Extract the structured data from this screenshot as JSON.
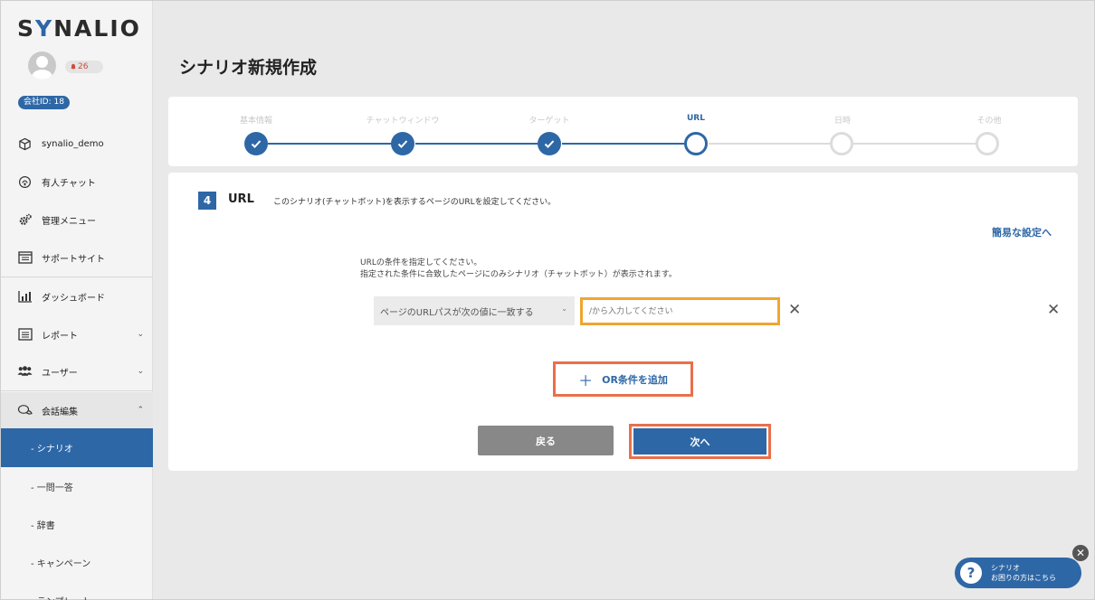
{
  "logo": {
    "pre": "S",
    "y": "Y",
    "post": "NALIO"
  },
  "user": {
    "notif_count": "26",
    "company_id": "会社ID: 18"
  },
  "nav": [
    {
      "label": "synalio_demo",
      "icon": "box-icon"
    },
    {
      "label": "有人チャット",
      "icon": "headset-icon"
    },
    {
      "label": "管理メニュー",
      "icon": "gears-icon"
    },
    {
      "label": "サポートサイト",
      "icon": "window-icon"
    },
    {
      "label": "ダッシュボード",
      "icon": "bar-chart-icon"
    },
    {
      "label": "レポート",
      "icon": "list-icon"
    },
    {
      "label": "ユーザー",
      "icon": "users-icon"
    },
    {
      "label": "会話編集",
      "icon": "chat-icon"
    }
  ],
  "subnav": [
    {
      "label": "- シナリオ",
      "active": true
    },
    {
      "label": "- 一問一答"
    },
    {
      "label": "- 辞書"
    },
    {
      "label": "- キャンペーン"
    },
    {
      "label": "- テンプレート"
    }
  ],
  "page_title": "シナリオ新規作成",
  "steps": [
    {
      "label": "基本情報",
      "state": "done"
    },
    {
      "label": "チャットウィンドウ",
      "state": "done"
    },
    {
      "label": "ターゲット",
      "state": "done"
    },
    {
      "label": "URL",
      "state": "current"
    },
    {
      "label": "日時",
      "state": "todo"
    },
    {
      "label": "その他",
      "state": "todo"
    }
  ],
  "section": {
    "number": "4",
    "title": "URL",
    "description": "このシナリオ(チャットボット)を表示するページのURLを設定してください。",
    "simple_link": "簡易な設定へ",
    "instruction_1": "URLの条件を指定してください。",
    "instruction_2": "指定された条件に合致したページにのみシナリオ（チャットボット）が表示されます。",
    "condition_select": "ページのURLパスが次の値に一致する",
    "url_placeholder": "/から入力してください",
    "or_button": "OR条件を追加",
    "back_button": "戻る",
    "next_button": "次へ"
  },
  "help": {
    "line1": "シナリオ",
    "line2": "お困りの方はこちら"
  },
  "colors": {
    "accent": "#2e67a6",
    "highlight_orange": "#e8704a",
    "input_orange": "#f0a630"
  }
}
